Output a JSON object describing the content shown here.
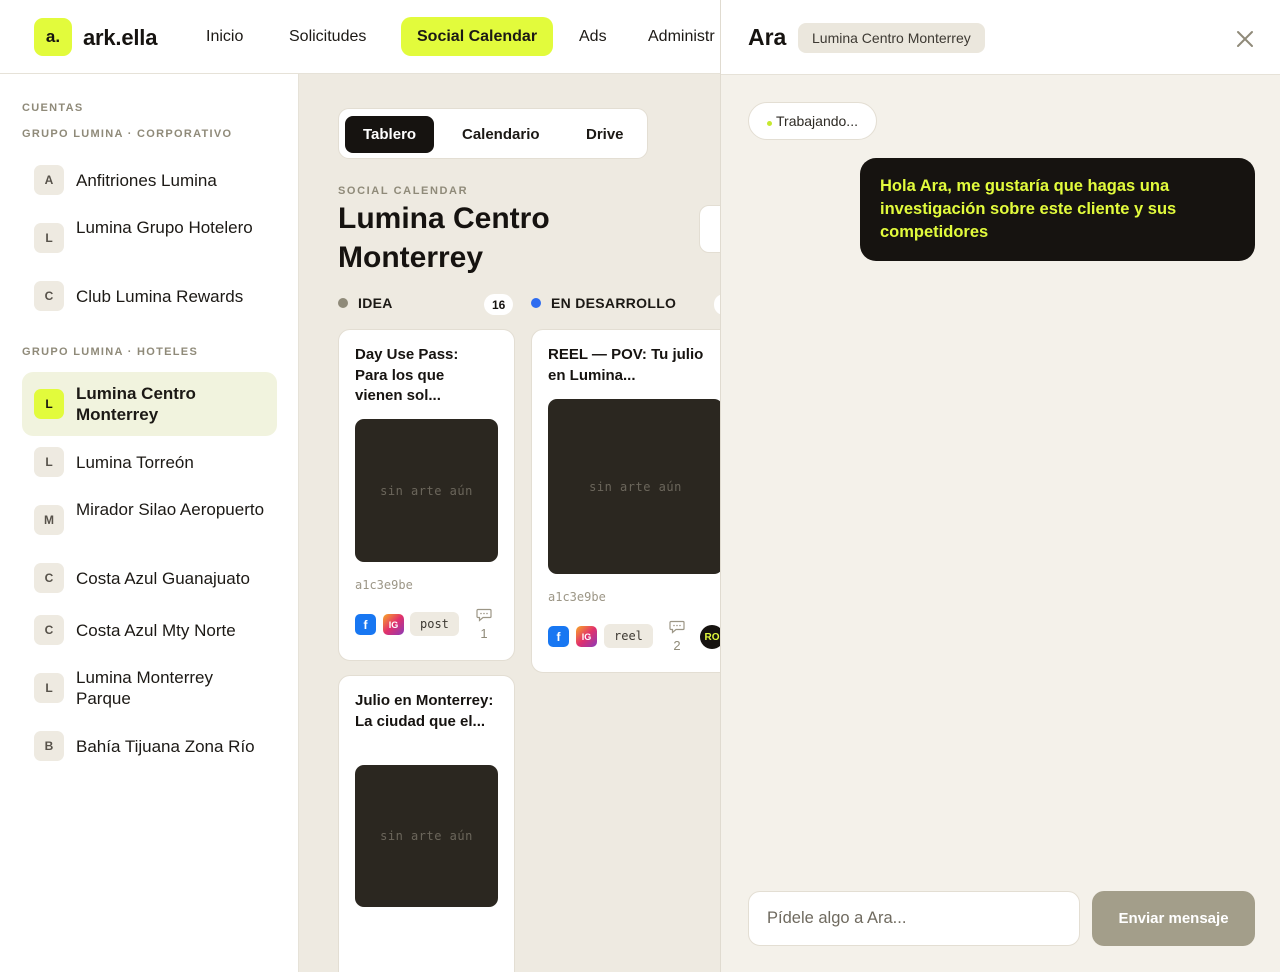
{
  "brand": {
    "mark": "a.",
    "name": "ark.ella",
    "accent": "#e2fb3c"
  },
  "nav": {
    "items": [
      {
        "label": "Inicio"
      },
      {
        "label": "Solicitudes"
      },
      {
        "label": "Social Calendar",
        "active": true
      },
      {
        "label": "Ads"
      },
      {
        "label": "Administr"
      }
    ]
  },
  "sidebar": {
    "title": "CUENTAS",
    "groups": [
      {
        "label": "GRUPO LUMINA · CORPORATIVO",
        "accounts": [
          {
            "initial": "A",
            "name": "Anfitriones Lumina"
          },
          {
            "initial": "L",
            "name": "Lumina Grupo Hotelero"
          },
          {
            "initial": "C",
            "name": "Club Lumina Rewards"
          }
        ]
      },
      {
        "label": "GRUPO LUMINA · HOTELES",
        "accounts": [
          {
            "initial": "L",
            "name": "Lumina Centro Monterrey",
            "active": true
          },
          {
            "initial": "L",
            "name": "Lumina Torreón"
          },
          {
            "initial": "M",
            "name": "Mirador Silao Aeropuerto"
          },
          {
            "initial": "C",
            "name": "Costa Azul Guanajuato"
          },
          {
            "initial": "C",
            "name": "Costa Azul Mty Norte"
          },
          {
            "initial": "L",
            "name": "Lumina Monterrey Parque"
          },
          {
            "initial": "B",
            "name": "Bahía Tijuana Zona Río"
          }
        ]
      }
    ]
  },
  "main": {
    "tabs": [
      {
        "label": "Tablero",
        "active": true
      },
      {
        "label": "Calendario"
      },
      {
        "label": "Drive"
      }
    ],
    "eyebrow": "SOCIAL CALENDAR",
    "title": "Lumina Centro Monterrey",
    "columns": [
      {
        "label": "IDEA",
        "count": "16",
        "color": "#8f8a79",
        "cards": [
          {
            "title": "Day Use Pass: Para los que vienen sol...",
            "art": "sin arte aún",
            "hash": "a1c3e9be",
            "networks": [
              "f",
              "IG"
            ],
            "type": "post",
            "comments": "1"
          },
          {
            "title": "Julio en Monterrey: La ciudad que el...",
            "art": "sin arte aún"
          }
        ]
      },
      {
        "label": "EN DESARROLLO",
        "color": "#2d6cf0",
        "cards": [
          {
            "title": "REEL — POV: Tu julio en Lumina...",
            "art": "sin arte aún",
            "hash": "a1c3e9be",
            "networks": [
              "f",
              "IG"
            ],
            "type": "reel",
            "comments": "2",
            "assignee": "RO"
          }
        ]
      }
    ]
  },
  "ara": {
    "title": "Ara",
    "context": "Lumina Centro Monterrey",
    "status": "Trabajando...",
    "messages": [
      {
        "from": "user",
        "text": "Hola Ara, me gustaría que hagas una investigación sobre este cliente y sus competidores"
      }
    ],
    "input_placeholder": "Pídele algo a Ara...",
    "send_label": "Enviar mensaje"
  }
}
